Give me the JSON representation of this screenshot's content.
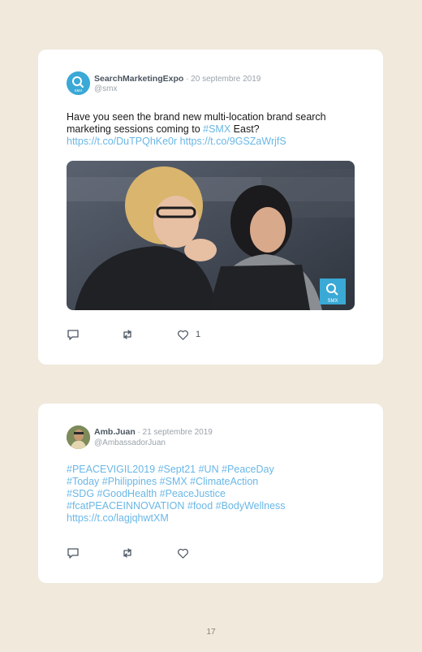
{
  "tweets": [
    {
      "author_name": "SearchMarketingExpo",
      "date": " · 20 septembre 2019",
      "handle": "@smx",
      "text_prefix": "Have you seen the brand new multi-location brand search marketing sessions coming to ",
      "hashtag": "#SMX",
      "text_suffix": " East?",
      "links": "https://t.co/DuTPQhKe0r https://t.co/9GSZaWrjfS",
      "avatar_text": "SMX",
      "photo_badge": "SMX",
      "like_count": "1"
    },
    {
      "author_name": "Amb.Juan",
      "date": " · 21 septembre 2019",
      "handle": "@AmbassadorJuan",
      "lines": [
        "#PEACEVIGIL2019 #Sept21 #UN #PeaceDay",
        "#Today #Philippines #SMX #ClimateAction",
        "#SDG #GoodHealth #PeaceJustice",
        "#fcatPEACEINNOVATION #food #BodyWellness",
        "https://t.co/lagjqhwtXM"
      ],
      "like_count": ""
    }
  ],
  "page_number": "17",
  "colors": {
    "background": "#f0e9dc",
    "card": "#ffffff",
    "link": "#6ab7e6",
    "smx_brand": "#3aa9d6"
  },
  "icons": [
    "reply-icon",
    "retweet-icon",
    "like-icon"
  ]
}
